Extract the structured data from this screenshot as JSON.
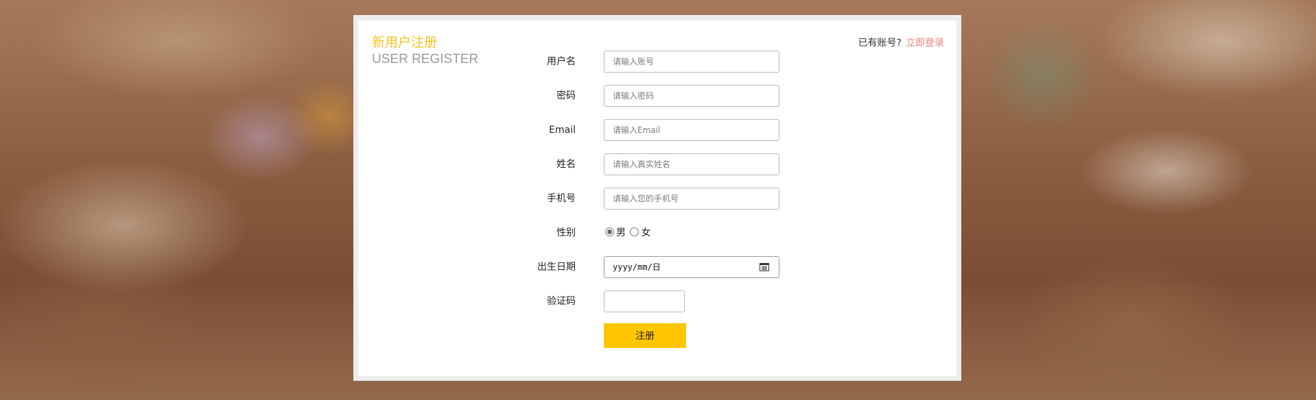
{
  "header": {
    "title_cn": "新用户注册",
    "title_en": "USER REGISTER"
  },
  "login": {
    "prompt": "已有账号?",
    "link": "立即登录"
  },
  "form": {
    "username": {
      "label": "用户名",
      "placeholder": "请输入账号"
    },
    "password": {
      "label": "密码",
      "placeholder": "请输入密码"
    },
    "email": {
      "label": "Email",
      "placeholder": "请输入Email"
    },
    "name": {
      "label": "姓名",
      "placeholder": "请输入真实姓名"
    },
    "phone": {
      "label": "手机号",
      "placeholder": "请输入您的手机号"
    },
    "gender": {
      "label": "性别",
      "options": [
        "男",
        "女"
      ],
      "selected": "男"
    },
    "birthdate": {
      "label": "出生日期",
      "value": "yyyy/mm/日"
    },
    "captcha": {
      "label": "验证码",
      "value": ""
    },
    "submit_label": "注册"
  },
  "colors": {
    "accent": "#f5c324",
    "button": "#ffc600",
    "link": "#ef7f7f"
  },
  "icons": {
    "calendar": "calendar-icon"
  }
}
